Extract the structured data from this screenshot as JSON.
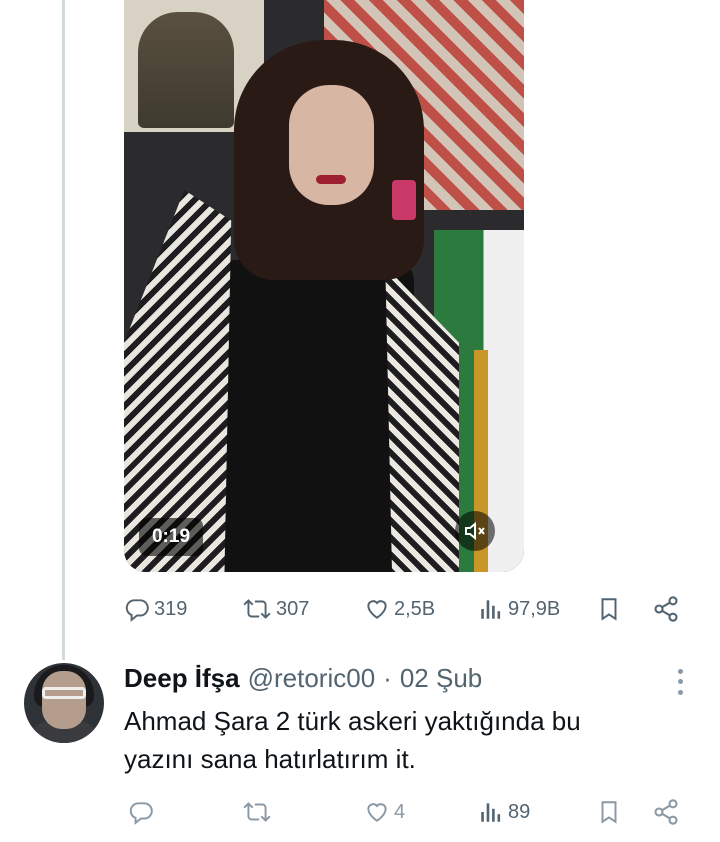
{
  "video": {
    "duration": "0:19",
    "mute_icon": "muted-speaker-icon"
  },
  "tweet_actions": {
    "replies": "319",
    "reposts": "307",
    "likes": "2,5B",
    "views": "97,9B"
  },
  "reply": {
    "display_name": "Deep İfşa",
    "handle": "@retoric00",
    "separator": "·",
    "date": "02 Şub",
    "text_line1": "Ahmad Şara 2 türk askeri yaktığında bu",
    "text_line2": "yazını sana hatırlatırım it.",
    "actions": {
      "replies": "",
      "reposts": "",
      "likes": "4",
      "views": "89"
    }
  },
  "colors": {
    "icon_gray": "#536471",
    "text": "#0f1419",
    "thread_line": "#cfd9de"
  }
}
